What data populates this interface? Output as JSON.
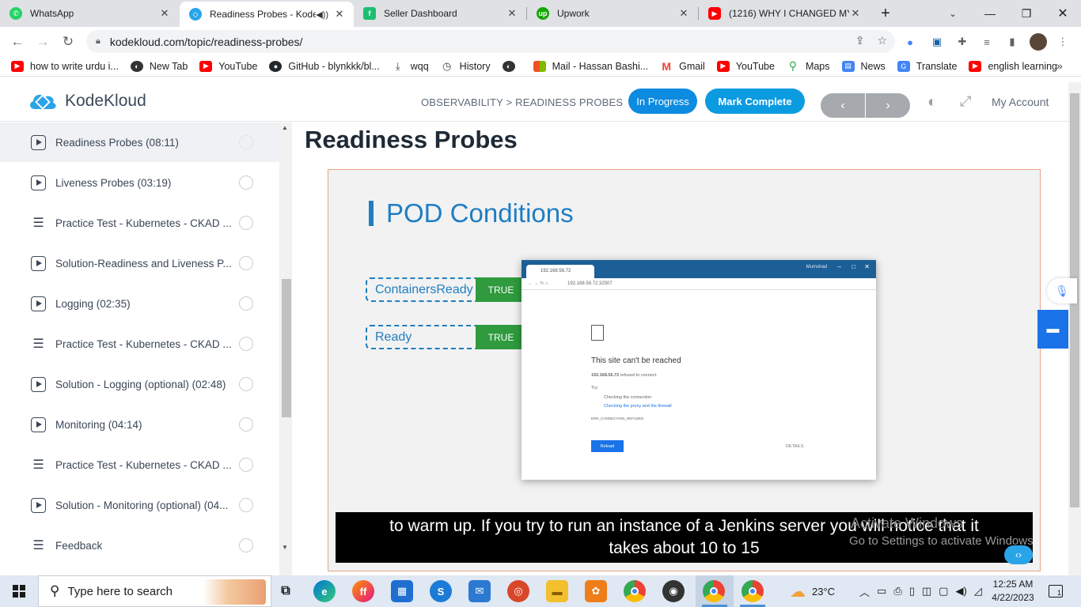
{
  "browser": {
    "tabs": [
      {
        "title": "WhatsApp",
        "icon": "whatsapp-icon",
        "color": "#25d366"
      },
      {
        "title": "Readiness Probes - Kode",
        "icon": "kodekloud-icon",
        "color": "#2aa4e8",
        "active": true
      },
      {
        "title": "Seller Dashboard",
        "icon": "fiverr-icon",
        "color": "#1dbf73"
      },
      {
        "title": "Upwork",
        "icon": "upwork-icon",
        "color": "#14a800"
      },
      {
        "title": "(1216) WHY I CHANGED MY",
        "icon": "youtube-icon",
        "color": "#ff0000"
      }
    ],
    "url": "kodekloud.com/topic/readiness-probes/",
    "bookmarks": [
      {
        "label": "how to write urdu i...",
        "icon": "youtube-icon",
        "color": "#ff0000"
      },
      {
        "label": "New Tab",
        "icon": "globe-icon",
        "color": "#333333"
      },
      {
        "label": "YouTube",
        "icon": "youtube-icon",
        "color": "#ff0000"
      },
      {
        "label": "GitHub - blynkkk/bl...",
        "icon": "github-icon",
        "color": "#24292e"
      },
      {
        "label": "wqq",
        "icon": "download-icon",
        "color": "#444444"
      },
      {
        "label": "History",
        "icon": "history-icon",
        "color": "#444444"
      },
      {
        "label": "",
        "icon": "globe-icon",
        "color": "#333333"
      },
      {
        "label": "Mail - Hassan Bashi...",
        "icon": "microsoft-icon",
        "color": "#f25022"
      },
      {
        "label": "Gmail",
        "icon": "gmail-icon",
        "color": "#ea4335"
      },
      {
        "label": "YouTube",
        "icon": "youtube-icon",
        "color": "#ff0000"
      },
      {
        "label": "Maps",
        "icon": "maps-icon",
        "color": "#34a853"
      },
      {
        "label": "News",
        "icon": "news-icon",
        "color": "#4285f4"
      },
      {
        "label": "Translate",
        "icon": "translate-icon",
        "color": "#4285f4"
      },
      {
        "label": "english learning",
        "icon": "youtube-icon",
        "color": "#ff0000"
      }
    ]
  },
  "site": {
    "brand": "KodeKloud",
    "breadcrumb": "OBSERVABILITY > READINESS PROBES",
    "in_progress": "In Progress",
    "mark_complete": "Mark Complete",
    "prev": "‹",
    "next": "›",
    "my_account": "My Account"
  },
  "sidebar": {
    "lessons": [
      {
        "label": "Readiness Probes (08:11)",
        "type": "video",
        "active": true
      },
      {
        "label": "Liveness Probes (03:19)",
        "type": "video"
      },
      {
        "label": "Practice Test - Kubernetes - CKAD ...",
        "type": "lab"
      },
      {
        "label": "Solution-Readiness and Liveness P...",
        "type": "video"
      },
      {
        "label": "Logging (02:35)",
        "type": "video"
      },
      {
        "label": "Practice Test - Kubernetes - CKAD ...",
        "type": "lab"
      },
      {
        "label": "Solution - Logging (optional) (02:48)",
        "type": "video"
      },
      {
        "label": "Monitoring (04:14)",
        "type": "video"
      },
      {
        "label": "Practice Test - Kubernetes - CKAD ...",
        "type": "lab"
      },
      {
        "label": "Solution - Monitoring (optional) (04...",
        "type": "video"
      },
      {
        "label": "Feedback",
        "type": "lab"
      }
    ]
  },
  "main": {
    "title": "Readiness Probes",
    "slide": {
      "heading": "POD Conditions",
      "conditions": [
        {
          "name": "ContainersReady",
          "value": "TRUE"
        },
        {
          "name": "Ready",
          "value": "TRUE"
        }
      ],
      "browser": {
        "tab": "192.168.56.72",
        "user": "Mumshad",
        "address": "192.168.56.72:32507",
        "heading": "This site can't be reached",
        "host": "192.168.56.72",
        "refused": "refused to connect.",
        "try": "Try:",
        "tip1": "Checking the connection",
        "tip2": "Checking the proxy and the firewall",
        "error": "ERR_CONNECTION_REFUSED",
        "reload": "Reload",
        "details": "DETAILS"
      }
    },
    "caption_line1": "to warm up. If you try to run an instance of a Jenkins server you will notice that it",
    "caption_line2": "takes about 10 to 15",
    "watermark_line1": "Activate Windows",
    "watermark_line2": "Go to Settings to activate Windows"
  },
  "taskbar": {
    "search_placeholder": "Type here to search",
    "weather": "23°C",
    "time": "12:25 AM",
    "date": "4/22/2023",
    "notifications": "1"
  }
}
